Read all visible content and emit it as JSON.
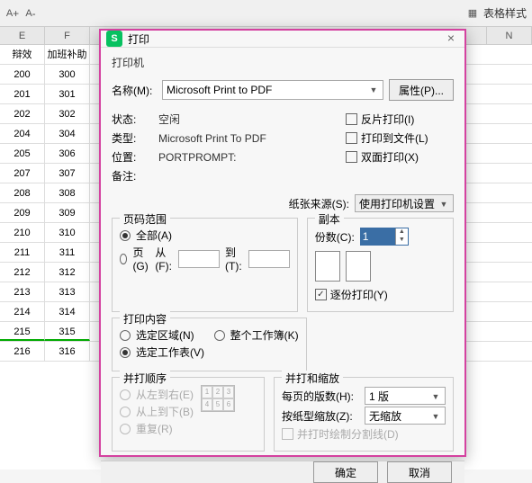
{
  "toolbar": {
    "style_label": "表格样式"
  },
  "sheet": {
    "columns": [
      "E",
      "F",
      "",
      "N"
    ],
    "headers": [
      "辩效",
      "加班补助"
    ],
    "rows": [
      [
        "200",
        "300"
      ],
      [
        "201",
        "301"
      ],
      [
        "202",
        "302"
      ],
      [
        "204",
        "304"
      ],
      [
        "205",
        "306"
      ],
      [
        "207",
        "307"
      ],
      [
        "208",
        "308"
      ],
      [
        "209",
        "309"
      ],
      [
        "210",
        "310"
      ],
      [
        "211",
        "311"
      ],
      [
        "212",
        "312"
      ],
      [
        "213",
        "313"
      ],
      [
        "214",
        "314"
      ],
      [
        "215",
        "315"
      ],
      [
        "216",
        "316"
      ]
    ],
    "green_row_index": 13
  },
  "dialog": {
    "title": "打印",
    "printer_section": "打印机",
    "name_label": "名称(M):",
    "name_value": "Microsoft Print to PDF",
    "properties_btn": "属性(P)...",
    "status_label": "状态:",
    "status_value": "空闲",
    "type_label": "类型:",
    "type_value": "Microsoft Print To PDF",
    "where_label": "位置:",
    "where_value": "PORTPROMPT:",
    "comment_label": "备注:",
    "chk_reverse": "反片打印(I)",
    "chk_tofile": "打印到文件(L)",
    "chk_duplex": "双面打印(X)",
    "paper_source_label": "纸张来源(S):",
    "paper_source_value": "使用打印机设置",
    "page_range": {
      "legend": "页码范围",
      "all": "全部(A)",
      "pages": "页(G)",
      "from": "从(F):",
      "to": "到(T):"
    },
    "copies": {
      "legend": "副本",
      "count_label": "份数(C):",
      "count_value": "1",
      "collate": "逐份打印(Y)"
    },
    "content": {
      "legend": "打印内容",
      "selection": "选定区域(N)",
      "workbook": "整个工作簿(K)",
      "sheet": "选定工作表(V)"
    },
    "order": {
      "legend": "并打顺序",
      "lr": "从左到右(E)",
      "tb": "从上到下(B)",
      "repeat": "重复(R)"
    },
    "scale": {
      "legend": "并打和缩放",
      "per_page_label": "每页的版数(H):",
      "per_page_value": "1 版",
      "zoom_label": "按纸型缩放(Z):",
      "zoom_value": "无缩放",
      "draw_lines": "并打时绘制分割线(D)"
    },
    "ok": "确定",
    "cancel": "取消"
  }
}
